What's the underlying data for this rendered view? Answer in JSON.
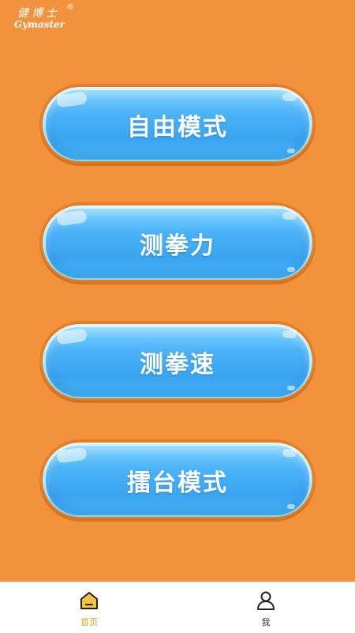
{
  "logo": {
    "cn": "健博士",
    "en": "Gymaster",
    "reg": "®"
  },
  "modes": [
    {
      "label": "自由模式"
    },
    {
      "label": "测拳力"
    },
    {
      "label": "测拳速"
    },
    {
      "label": "擂台模式"
    }
  ],
  "tabbar": {
    "home": {
      "label": "首页",
      "icon": "home-icon"
    },
    "me": {
      "label": "我",
      "icon": "user-icon"
    }
  },
  "colors": {
    "background": "#F2923D",
    "button_blue": "#3AA4F1",
    "active_tab": "#E6A21A"
  }
}
